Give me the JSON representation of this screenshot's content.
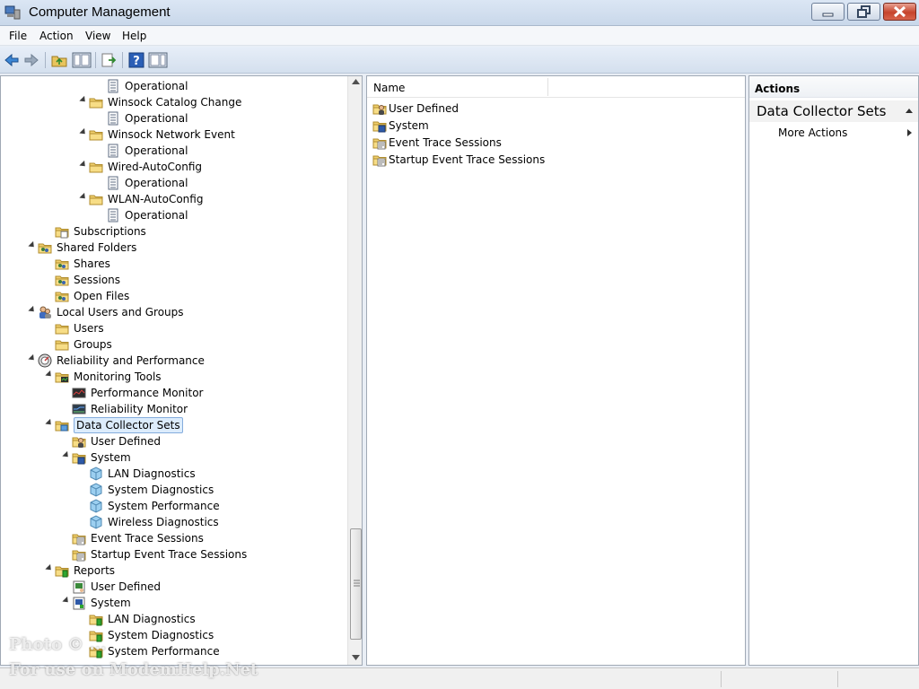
{
  "window": {
    "title": "Computer Management"
  },
  "menu": [
    "File",
    "Action",
    "View",
    "Help"
  ],
  "tree": [
    {
      "label": "Operational",
      "icon": "log-icon",
      "level": 6,
      "exp": false
    },
    {
      "label": "Winsock Catalog Change",
      "icon": "folder-icon",
      "level": 5,
      "exp": true
    },
    {
      "label": "Operational",
      "icon": "log-icon",
      "level": 6,
      "exp": false
    },
    {
      "label": "Winsock Network Event",
      "icon": "folder-icon",
      "level": 5,
      "exp": true
    },
    {
      "label": "Operational",
      "icon": "log-icon",
      "level": 6,
      "exp": false
    },
    {
      "label": "Wired-AutoConfig",
      "icon": "folder-icon",
      "level": 5,
      "exp": true
    },
    {
      "label": "Operational",
      "icon": "log-icon",
      "level": 6,
      "exp": false
    },
    {
      "label": "WLAN-AutoConfig",
      "icon": "folder-icon",
      "level": 5,
      "exp": true
    },
    {
      "label": "Operational",
      "icon": "log-icon",
      "level": 6,
      "exp": false
    },
    {
      "label": "Subscriptions",
      "icon": "subscriptions-icon",
      "level": 3,
      "exp": false
    },
    {
      "label": "Shared Folders",
      "icon": "shared-folder-icon",
      "level": 2,
      "exp": true
    },
    {
      "label": "Shares",
      "icon": "shared-folder-icon",
      "level": 3,
      "exp": false
    },
    {
      "label": "Sessions",
      "icon": "shared-folder-icon",
      "level": 3,
      "exp": false
    },
    {
      "label": "Open Files",
      "icon": "shared-folder-icon",
      "level": 3,
      "exp": false
    },
    {
      "label": "Local Users and Groups",
      "icon": "users-icon",
      "level": 2,
      "exp": true
    },
    {
      "label": "Users",
      "icon": "folder-icon",
      "level": 3,
      "exp": false
    },
    {
      "label": "Groups",
      "icon": "folder-icon",
      "level": 3,
      "exp": false
    },
    {
      "label": "Reliability and Performance",
      "icon": "gauge-icon",
      "level": 2,
      "exp": true
    },
    {
      "label": "Monitoring Tools",
      "icon": "monitor-folder-icon",
      "level": 3,
      "exp": true
    },
    {
      "label": "Performance Monitor",
      "icon": "perf-monitor-icon",
      "level": 4,
      "exp": false
    },
    {
      "label": "Reliability Monitor",
      "icon": "rel-monitor-icon",
      "level": 4,
      "exp": false
    },
    {
      "label": "Data Collector Sets",
      "icon": "dcs-icon",
      "level": 3,
      "exp": true,
      "selected": true
    },
    {
      "label": "User Defined",
      "icon": "user-folder-icon",
      "level": 4,
      "exp": false
    },
    {
      "label": "System",
      "icon": "system-folder-icon",
      "level": 4,
      "exp": true
    },
    {
      "label": "LAN Diagnostics",
      "icon": "cube-icon",
      "level": 5,
      "exp": false
    },
    {
      "label": "System Diagnostics",
      "icon": "cube-icon",
      "level": 5,
      "exp": false
    },
    {
      "label": "System Performance",
      "icon": "cube-icon",
      "level": 5,
      "exp": false
    },
    {
      "label": "Wireless Diagnostics",
      "icon": "cube-icon",
      "level": 5,
      "exp": false
    },
    {
      "label": "Event Trace Sessions",
      "icon": "trace-folder-icon",
      "level": 4,
      "exp": false
    },
    {
      "label": "Startup Event Trace Sessions",
      "icon": "trace-folder-icon",
      "level": 4,
      "exp": false
    },
    {
      "label": "Reports",
      "icon": "report-folder-icon",
      "level": 3,
      "exp": true
    },
    {
      "label": "User Defined",
      "icon": "report-user-icon",
      "level": 4,
      "exp": false
    },
    {
      "label": "System",
      "icon": "report-system-icon",
      "level": 4,
      "exp": true
    },
    {
      "label": "LAN Diagnostics",
      "icon": "report-folder-icon",
      "level": 5,
      "exp": false
    },
    {
      "label": "System Diagnostics",
      "icon": "report-folder-icon",
      "level": 5,
      "exp": false
    },
    {
      "label": "System Performance",
      "icon": "report-folder-icon",
      "level": 5,
      "exp": false
    }
  ],
  "list": {
    "column_header": "Name",
    "items": [
      {
        "label": "User Defined",
        "icon": "user-folder-icon"
      },
      {
        "label": "System",
        "icon": "system-folder-icon"
      },
      {
        "label": "Event Trace Sessions",
        "icon": "trace-folder-icon"
      },
      {
        "label": "Startup Event Trace Sessions",
        "icon": "trace-folder-icon"
      }
    ]
  },
  "actions": {
    "title": "Actions",
    "group": "Data Collector Sets",
    "more": "More Actions"
  },
  "watermark": {
    "line1": "Photo © ...",
    "line2": "For use on ModemHelp.Net"
  }
}
